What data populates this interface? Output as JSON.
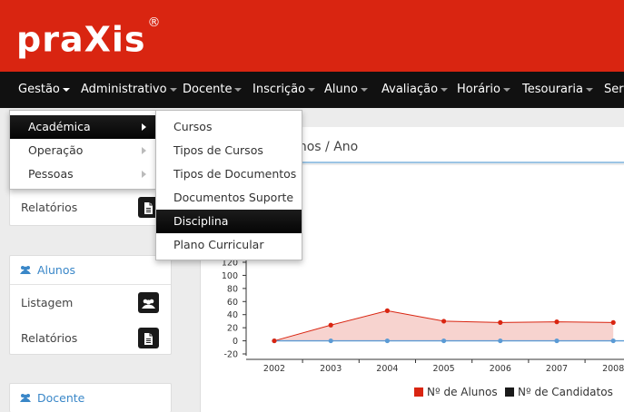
{
  "app": {
    "logo": "praXis",
    "logo_mark": "®"
  },
  "nav": [
    {
      "label": "Gestão"
    },
    {
      "label": "Administrativo"
    },
    {
      "label": "Docente"
    },
    {
      "label": "Inscrição"
    },
    {
      "label": "Aluno"
    },
    {
      "label": "Avaliação"
    },
    {
      "label": "Horário"
    },
    {
      "label": "Tesouraria"
    },
    {
      "label": "Serv"
    }
  ],
  "dropdown": [
    {
      "label": "Académica"
    },
    {
      "label": "Operação"
    },
    {
      "label": "Pessoas"
    }
  ],
  "submenu": [
    {
      "label": "Cursos"
    },
    {
      "label": "Tipos de Cursos"
    },
    {
      "label": "Tipos de Documentos"
    },
    {
      "label": "Documentos Suporte"
    },
    {
      "label": "Disciplina"
    },
    {
      "label": "Plano Curricular"
    }
  ],
  "sidebar": {
    "box1": {
      "row": "Relatórios"
    },
    "alunos": {
      "title": "Alunos",
      "rows": [
        "Listagem",
        "Relatórios"
      ]
    },
    "docente": {
      "title": "Docente"
    }
  },
  "page": {
    "title": "unos / Ano"
  },
  "colors": {
    "brand": "#d92511",
    "alunos": "#d92511",
    "candidatos": "#1a1a1a",
    "link": "#3a87c8"
  },
  "chart_data": {
    "type": "line",
    "categories": [
      "2002",
      "2003",
      "2004",
      "2005",
      "2006",
      "2007",
      "2008"
    ],
    "yticks": [
      -20,
      0,
      20,
      40,
      60,
      80,
      100,
      120
    ],
    "ylim": [
      -20,
      120
    ],
    "series": [
      {
        "name": "Nº de Alunos",
        "values": [
          0,
          24,
          46,
          30,
          28,
          29,
          28
        ]
      },
      {
        "name": "Nº de Candidatos",
        "values": [
          0,
          0,
          0,
          0,
          0,
          0,
          0
        ]
      }
    ],
    "legend": "bottom"
  }
}
